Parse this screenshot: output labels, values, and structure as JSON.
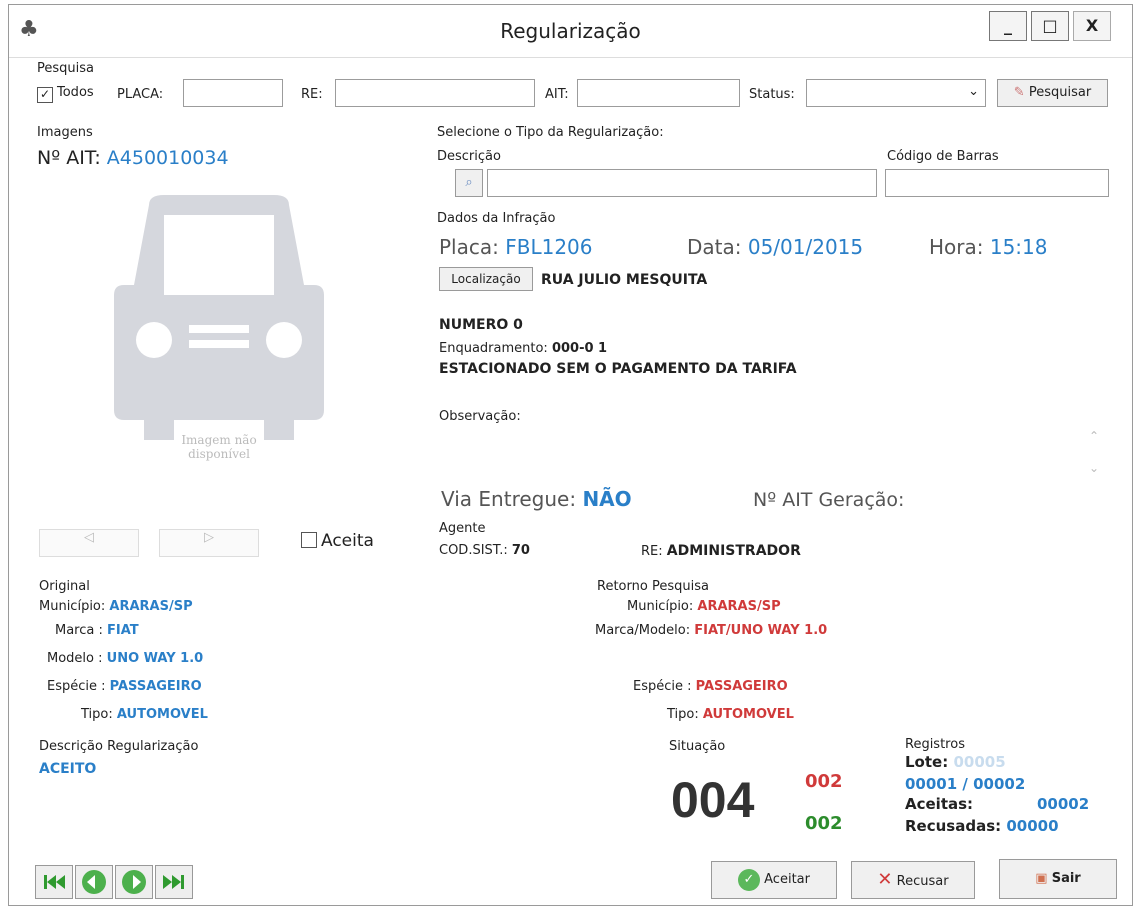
{
  "window": {
    "title": "Regularização",
    "min": "_",
    "max": "□",
    "close": "X"
  },
  "search": {
    "section": "Pesquisa",
    "todos": "Todos",
    "placa_label": "PLACA:",
    "re_label": "RE:",
    "ait_label": "AIT:",
    "status_label": "Status:",
    "status_value": "",
    "button": "Pesquisar"
  },
  "images": {
    "section": "Imagens",
    "ait_label": "Nº AIT:",
    "ait_value": "A450010034",
    "placeholder": "Imagem não disponível",
    "aceita": "Aceita"
  },
  "tipo": {
    "section": "Selecione o Tipo da Regularização:",
    "descricao": "Descrição",
    "codigo": "Código de Barras"
  },
  "infracao": {
    "section": "Dados da Infração",
    "placa_label": "Placa:",
    "placa": "FBL1206",
    "data_label": "Data:",
    "data": "05/01/2015",
    "hora_label": "Hora:",
    "hora": "15:18",
    "localizacao_btn": "Localização",
    "rua": "RUA JULIO MESQUITA",
    "numero": "NUMERO 0",
    "enq_label": "Enquadramento:",
    "enq_value": "000-0 1",
    "descricao": "ESTACIONADO SEM O PAGAMENTO DA TARIFA",
    "obs_label": "Observação:",
    "via_label": "Via Entregue:",
    "via_value": "NÃO",
    "ait_geracao": "Nº AIT Geração:"
  },
  "agente": {
    "section": "Agente",
    "cod_label": "COD.SIST.:",
    "cod_value": "70",
    "re_label": "RE:",
    "re_value": "ADMINISTRADOR"
  },
  "original": {
    "section": "Original",
    "municipio_label": "Município:",
    "municipio": "ARARAS/SP",
    "marca_label": "Marca :",
    "marca": "FIAT",
    "modelo_label": "Modelo :",
    "modelo": "UNO WAY 1.0",
    "especie_label": "Espécie :",
    "especie": "PASSAGEIRO",
    "tipo_label": "Tipo:",
    "tipo": "AUTOMOVEL"
  },
  "retorno": {
    "section": "Retorno Pesquisa",
    "municipio_label": "Município:",
    "municipio": "ARARAS/SP",
    "marca_label": "Marca/Modelo:",
    "marca": "FIAT/UNO WAY 1.0",
    "especie_label": "Espécie :",
    "especie": "PASSAGEIRO",
    "tipo_label": "Tipo:",
    "tipo": "AUTOMOVEL"
  },
  "regularizacao": {
    "section": "Descrição Regularização",
    "value": "ACEITO"
  },
  "situacao": {
    "section": "Situação",
    "main": "004",
    "red": "002",
    "green": "002"
  },
  "registros": {
    "section": "Registros",
    "lote_label": "Lote:",
    "lote_value": "00005",
    "pos": "00001 / 00002",
    "aceitas_label": "Aceitas:",
    "aceitas": "00002",
    "recusadas_label": "Recusadas:",
    "recusadas": "00000"
  },
  "actions": {
    "aceitar": "Aceitar",
    "recusar": "Recusar",
    "sair": "Sair"
  },
  "colors": {
    "blue": "#2a7fc8",
    "red": "#d03a3a",
    "green": "#2c8c2c"
  }
}
